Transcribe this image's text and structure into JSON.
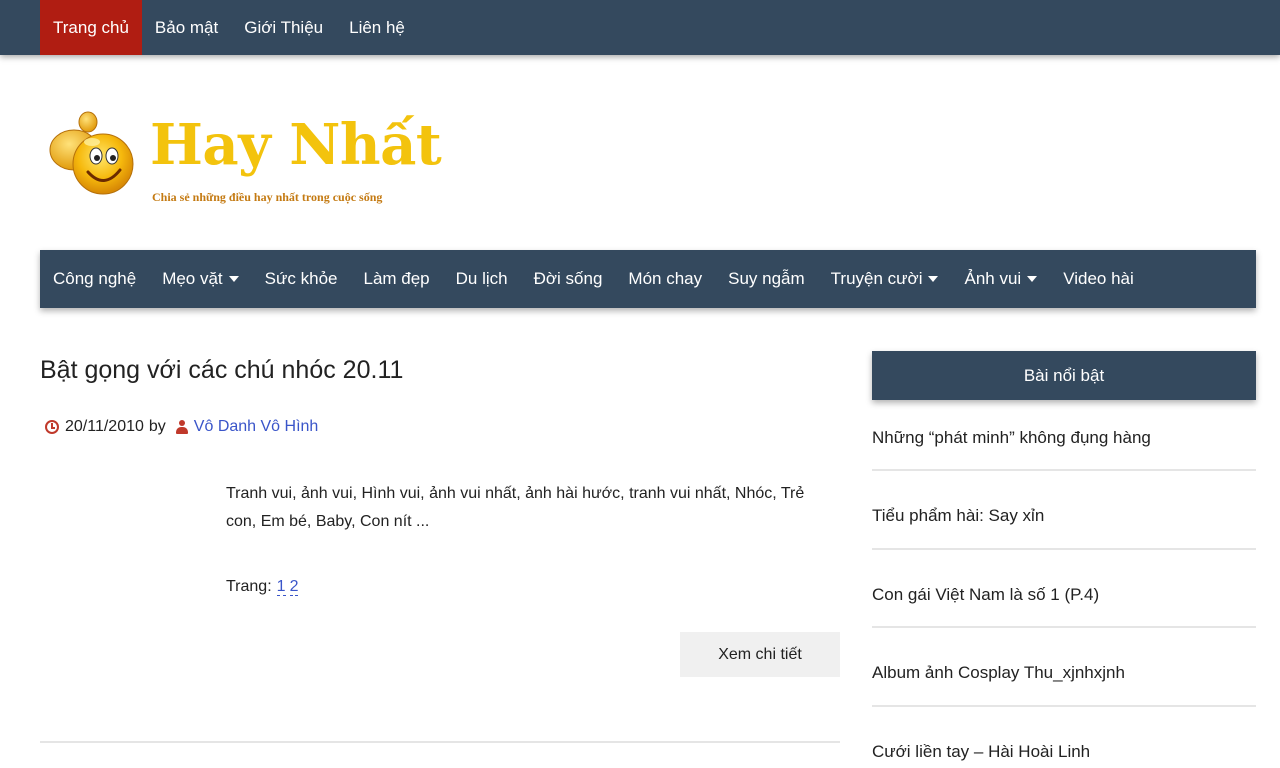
{
  "topnav": {
    "items": [
      {
        "label": "Trang chủ",
        "active": true
      },
      {
        "label": "Bảo mật"
      },
      {
        "label": "Giới Thiệu"
      },
      {
        "label": "Liên hệ"
      }
    ]
  },
  "logo": {
    "title": "Hay Nhất",
    "tagline": "Chia sẻ những điều hay nhất trong cuộc sống",
    "icon": "thumbs-up-smiley-icon"
  },
  "mainnav": {
    "items": [
      {
        "label": "Công nghệ",
        "dropdown": false
      },
      {
        "label": "Mẹo vặt",
        "dropdown": true
      },
      {
        "label": "Sức khỏe",
        "dropdown": false
      },
      {
        "label": "Làm đẹp",
        "dropdown": false
      },
      {
        "label": "Du lịch",
        "dropdown": false
      },
      {
        "label": "Đời sống",
        "dropdown": false
      },
      {
        "label": "Món chay",
        "dropdown": false
      },
      {
        "label": "Suy ngẫm",
        "dropdown": false
      },
      {
        "label": "Truyện cười",
        "dropdown": true
      },
      {
        "label": "Ảnh vui",
        "dropdown": true
      },
      {
        "label": "Video hài",
        "dropdown": false
      }
    ]
  },
  "post": {
    "title": "Bật gọng với các chú nhóc 20.11",
    "date": "20/11/2010",
    "by": "by",
    "author": "Vô Danh Vô Hình",
    "excerpt": "Tranh vui, ảnh vui, Hình vui, ảnh vui nhất, ảnh hài hước, tranh vui nhất, Nhóc, Trẻ con, Em bé, Baby, Con nít ...",
    "pages_label": "Trang:",
    "pages": [
      "1",
      "2"
    ],
    "read_more": "Xem chi tiết"
  },
  "sidebar": {
    "heading": "Bài nổi bật",
    "items": [
      "Những “phát minh” không đụng hàng",
      "Tiểu phẩm hài: Say xỉn",
      "Con gái Việt Nam là số 1 (P.4)",
      "Album ảnh Cosplay Thu_xjnhxjnh",
      "Cưới liền tay – Hài Hoài Linh"
    ]
  },
  "colors": {
    "nav_bg": "#34495e",
    "active_red": "#b01d12",
    "logo_yellow": "#f3c30d",
    "link_blue": "#3a55c9",
    "icon_red": "#c0392b"
  }
}
